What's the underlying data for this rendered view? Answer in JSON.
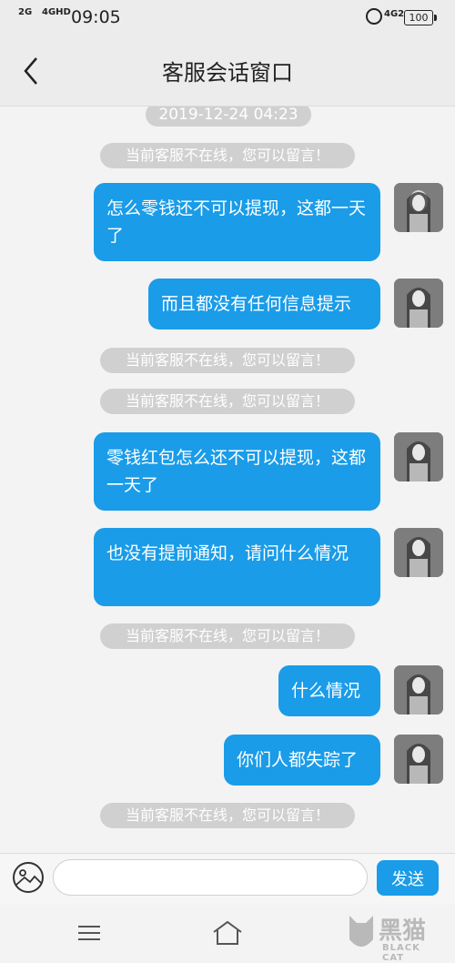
{
  "status_bar": {
    "signal_1": "2G",
    "signal_2": "4GHD",
    "time": "09:05",
    "network": "4G2",
    "battery": "100",
    "icons": [
      "signal-icon",
      "alarm-icon",
      "battery-icon"
    ]
  },
  "header": {
    "back_icon": "chevron-left-icon",
    "title": "客服会话窗口"
  },
  "chat": {
    "timestamp": "2019-12-24 04:23",
    "system_notice": "当前客服不在线，您可以留言！",
    "messages": [
      {
        "type": "system",
        "text": "当前客服不在线，您可以留言！"
      },
      {
        "type": "user",
        "text": "怎么零钱还不可以提现，这都一天了"
      },
      {
        "type": "user",
        "text": "而且都没有任何信息提示"
      },
      {
        "type": "system",
        "text": "当前客服不在线，您可以留言！"
      },
      {
        "type": "system",
        "text": "当前客服不在线，您可以留言！"
      },
      {
        "type": "user",
        "text": "零钱红包怎么还不可以提现，这都一天了"
      },
      {
        "type": "user",
        "text": "也没有提前通知，请问什么情况"
      },
      {
        "type": "system",
        "text": "当前客服不在线，您可以留言！"
      },
      {
        "type": "user",
        "text": "什么情况"
      },
      {
        "type": "user",
        "text": "你们人都失踪了"
      },
      {
        "type": "system",
        "text": "当前客服不在线，您可以留言！"
      }
    ]
  },
  "input_bar": {
    "image_icon": "image-picker-icon",
    "placeholder": "",
    "value": "",
    "send_label": "发送"
  },
  "system_nav": {
    "menu_icon": "menu-icon",
    "home_icon": "home-icon"
  },
  "watermark": {
    "text_cn": "黑猫",
    "text_en": "BLACK CAT"
  },
  "colors": {
    "accent": "#1a9ce8",
    "system_bubble": "#d0d0d0",
    "background": "#f3f3f3"
  }
}
